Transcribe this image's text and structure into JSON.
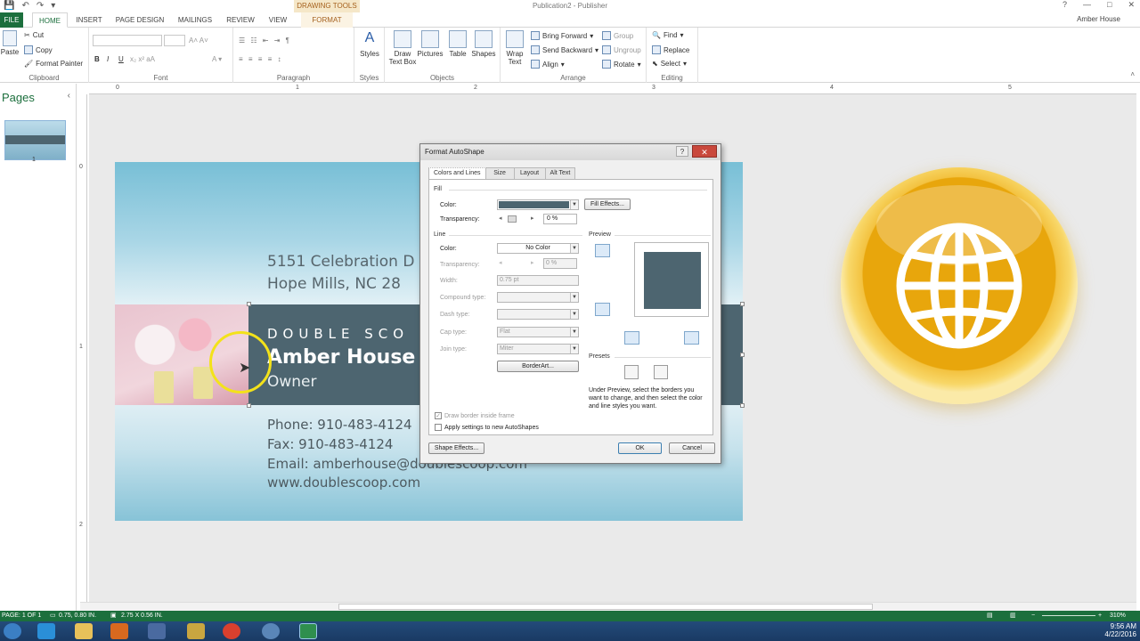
{
  "window": {
    "title": "Publication2 - Publisher",
    "context_tools": "DRAWING TOOLS",
    "user": "Amber House",
    "controls": [
      "?",
      "—",
      "□",
      "✕"
    ]
  },
  "tabs": [
    "FILE",
    "HOME",
    "INSERT",
    "PAGE DESIGN",
    "MAILINGS",
    "REVIEW",
    "VIEW",
    "FORMAT"
  ],
  "ribbon": {
    "clipboard": {
      "label": "Clipboard",
      "paste": "Paste",
      "cut": "Cut",
      "copy": "Copy",
      "format_painter": "Format Painter"
    },
    "font": {
      "label": "Font"
    },
    "paragraph": {
      "label": "Paragraph"
    },
    "styles": {
      "label": "Styles",
      "button": "Styles"
    },
    "objects": {
      "label": "Objects",
      "draw_text_box": "Draw Text Box",
      "pictures": "Pictures",
      "table": "Table",
      "shapes": "Shapes"
    },
    "arrange": {
      "label": "Arrange",
      "wrap_text": "Wrap Text",
      "bring_forward": "Bring Forward",
      "send_backward": "Send Backward",
      "align": "Align",
      "group": "Group",
      "ungroup": "Ungroup",
      "rotate": "Rotate"
    },
    "editing": {
      "label": "Editing",
      "find": "Find",
      "replace": "Replace",
      "select": "Select"
    }
  },
  "pages_pane": {
    "title": "Pages",
    "page_number": "1"
  },
  "ruler": {
    "h_ticks": [
      "0",
      "1",
      "2",
      "3",
      "4",
      "5"
    ],
    "v_ticks": [
      "0",
      "1",
      "2"
    ]
  },
  "card": {
    "address1": "5151 Celebration D",
    "address2": "Hope Mills, NC  28",
    "company": "DOUBLE SCO",
    "name": "Amber House",
    "title": "Owner",
    "phone": "Phone: 910-483-4124",
    "fax": "Fax: 910-483-4124",
    "email": "Email: amberhouse@doublescoop.com",
    "web": "www.doublescoop.com"
  },
  "dialog": {
    "title": "Format AutoShape",
    "help": "?",
    "close": "✕",
    "tabs": [
      "Colors and Lines",
      "Size",
      "Layout",
      "Alt Text"
    ],
    "fill": {
      "section": "Fill",
      "color_label": "Color:",
      "fill_color": "#4d6570",
      "fill_effects": "Fill Effects...",
      "transparency_label": "Transparency:",
      "transparency_value": "0 %"
    },
    "line": {
      "section": "Line",
      "color_label": "Color:",
      "color_value": "No Color",
      "transparency_label": "Transparency:",
      "transparency_value": "0 %",
      "width_label": "Width:",
      "width_value": "0.75 pt",
      "compound_label": "Compound type:",
      "dash_label": "Dash type:",
      "cap_label": "Cap type:",
      "cap_value": "Flat",
      "join_label": "Join type:",
      "join_value": "Miter",
      "border_art": "BorderArt..."
    },
    "preview_label": "Preview",
    "presets_label": "Presets",
    "note": "Under Preview, select the borders you want to change, and then select the color and line styles you want.",
    "draw_border_inside": "Draw border inside frame",
    "apply_new": "Apply settings to new AutoShapes",
    "shape_effects": "Shape Effects...",
    "ok": "OK",
    "cancel": "Cancel"
  },
  "statusbar": {
    "page": "PAGE: 1 OF 1",
    "position": "0.75, 0.80 IN.",
    "size": "2.75 X 0.56 IN.",
    "zoom": "310%"
  },
  "tray": {
    "time": "9:56 AM",
    "date": "4/22/2016"
  },
  "colors": {
    "accent": "#1c6f3d",
    "band": "#4d6570",
    "format_tab": "#a5611e"
  }
}
